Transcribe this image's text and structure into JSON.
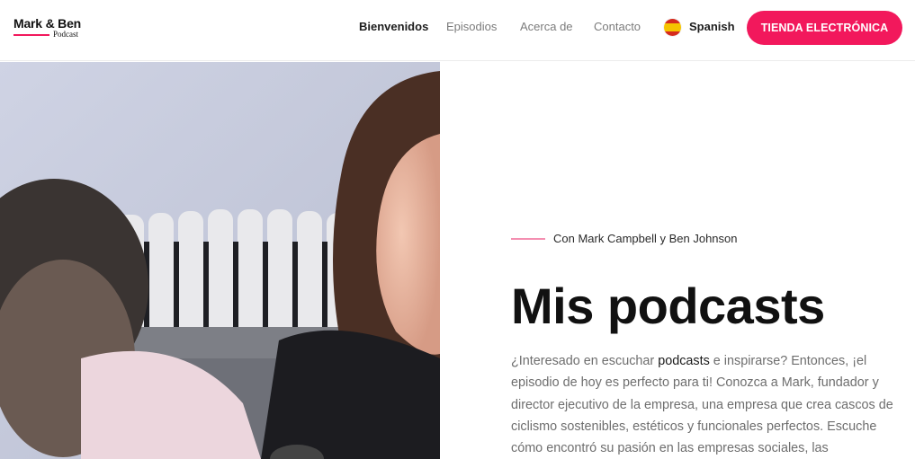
{
  "brand": {
    "title": "Mark & Ben",
    "subtitle": "Podcast",
    "accent": "#f2185c"
  },
  "nav": {
    "items": [
      {
        "label": "Bienvenidos",
        "active": true
      },
      {
        "label": "Episodios",
        "active": false
      },
      {
        "label": "Acerca de",
        "active": false
      },
      {
        "label": "Contacto",
        "active": false
      }
    ]
  },
  "language": {
    "label": "Spanish",
    "icon": "spain-flag-icon"
  },
  "shop_button": {
    "label": "TIENDA ELECTRÓNICA"
  },
  "hero": {
    "byline": "Con Mark Campbell y Ben Johnson",
    "title": "Mis podcasts",
    "body_before": "¿Interesado en escuchar ",
    "body_highlight": "podcasts",
    "body_after": " e inspirarse? Entonces, ¡el episodio de hoy es perfecto para ti! Conozca a Mark, fundador y director ejecutivo de la empresa, una empresa que crea cascos de ciclismo sostenibles, estéticos y funcionales perfectos. Escuche cómo encontró su pasión en las empresas sociales, las"
  }
}
